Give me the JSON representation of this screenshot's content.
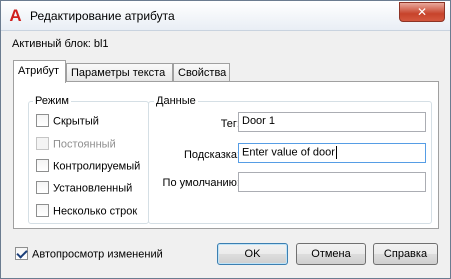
{
  "window": {
    "title": "Редактирование атрибута",
    "close_glyph": "✕",
    "app_icon_glyph": "A"
  },
  "active_block": {
    "text": "Активный блок: bl1"
  },
  "tabs": [
    {
      "label": "Атрибут",
      "active": true
    },
    {
      "label": "Параметры текста",
      "active": false
    },
    {
      "label": "Свойства",
      "active": false
    }
  ],
  "mode_group": {
    "label": "Режим",
    "options": [
      {
        "label": "Скрытый",
        "checked": false,
        "enabled": true
      },
      {
        "label": "Постоянный",
        "checked": false,
        "enabled": false
      },
      {
        "label": "Контролируемый",
        "checked": false,
        "enabled": true
      },
      {
        "label": "Установленный",
        "checked": false,
        "enabled": true
      },
      {
        "label": "Несколько строк",
        "checked": false,
        "enabled": true
      }
    ]
  },
  "data_group": {
    "label": "Данные",
    "tag_label": "Тег:",
    "tag_value": "Door 1",
    "prompt_label": "Подсказка:",
    "prompt_value": "Enter value of door",
    "default_label": "По умолчанию:",
    "default_value": ""
  },
  "footer": {
    "autopreview_label": "Автопросмотр изменений",
    "autopreview_checked": true,
    "ok_label": "OK",
    "cancel_label": "Отмена",
    "help_label": "Справка"
  },
  "colors": {
    "app_icon": "#d0201f",
    "close_button": "#c7432b",
    "focus_border": "#569de5"
  }
}
